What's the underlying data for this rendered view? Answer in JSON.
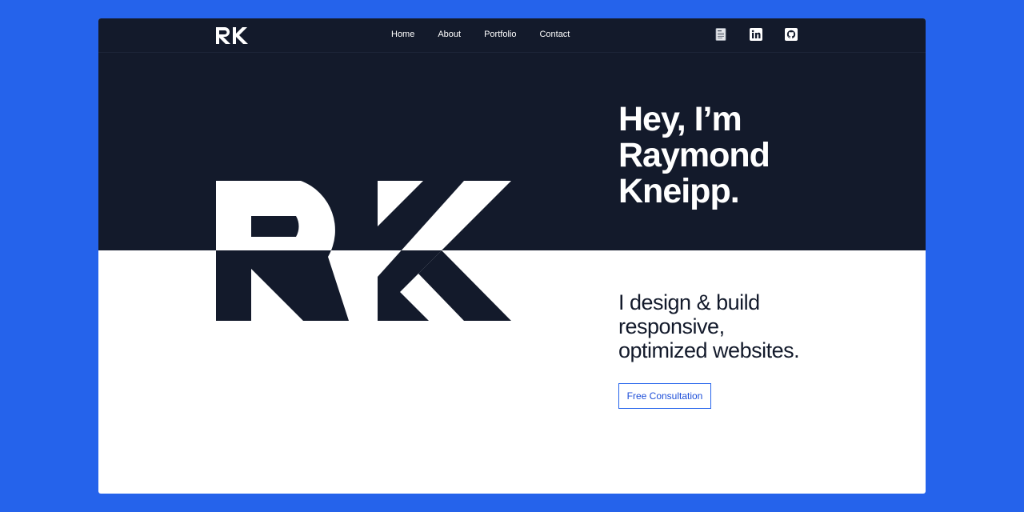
{
  "nav": {
    "logo_text": "RK",
    "links": [
      {
        "label": "Home"
      },
      {
        "label": "About"
      },
      {
        "label": "Portfolio"
      },
      {
        "label": "Contact"
      }
    ],
    "icons": [
      "resume-document-icon",
      "linkedin-icon",
      "github-icon"
    ]
  },
  "hero": {
    "logo_text": "RK",
    "headline_lines": [
      "Hey, I’m",
      "Raymond",
      "Kneipp."
    ],
    "tagline_lines": [
      "I design & build",
      "responsive,",
      "optimized websites."
    ],
    "cta_label": "Free Consultation"
  },
  "colors": {
    "page_background": "#2563eb",
    "dark_band": "#131a2b",
    "accent": "#2563eb",
    "text_dark": "#131a2b"
  }
}
